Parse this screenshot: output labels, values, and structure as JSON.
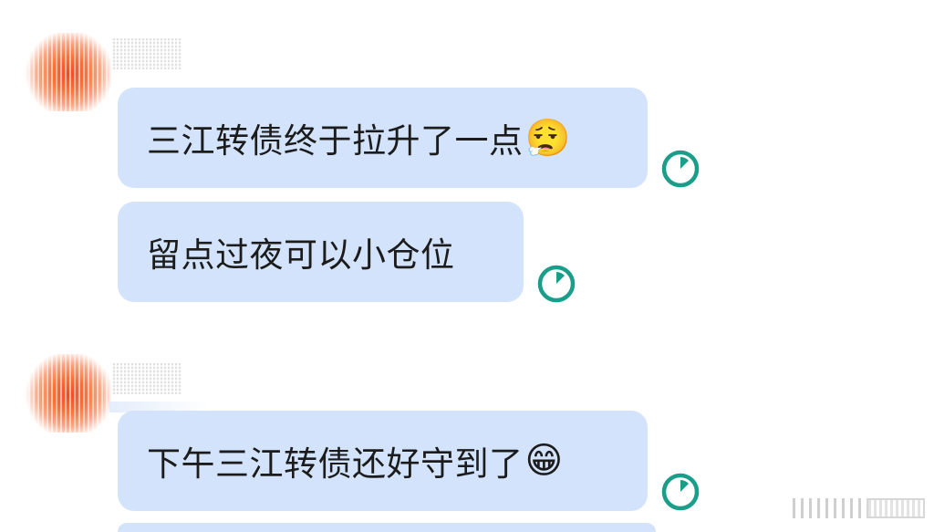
{
  "messages": [
    {
      "text": "三江转债终于拉升了一点",
      "emoji": "😮‍💨",
      "status_icon": "pending-clock-icon"
    },
    {
      "text": "留点过夜可以小仓位",
      "emoji": "",
      "status_icon": "pending-clock-icon"
    },
    {
      "text": "下午三江转债还好守到了",
      "emoji": "😁",
      "status_icon": "pending-clock-icon"
    }
  ],
  "colors": {
    "bubble": "#d2e3fb",
    "status_icon": "#1a9e8a",
    "avatar": "#f04a22"
  }
}
